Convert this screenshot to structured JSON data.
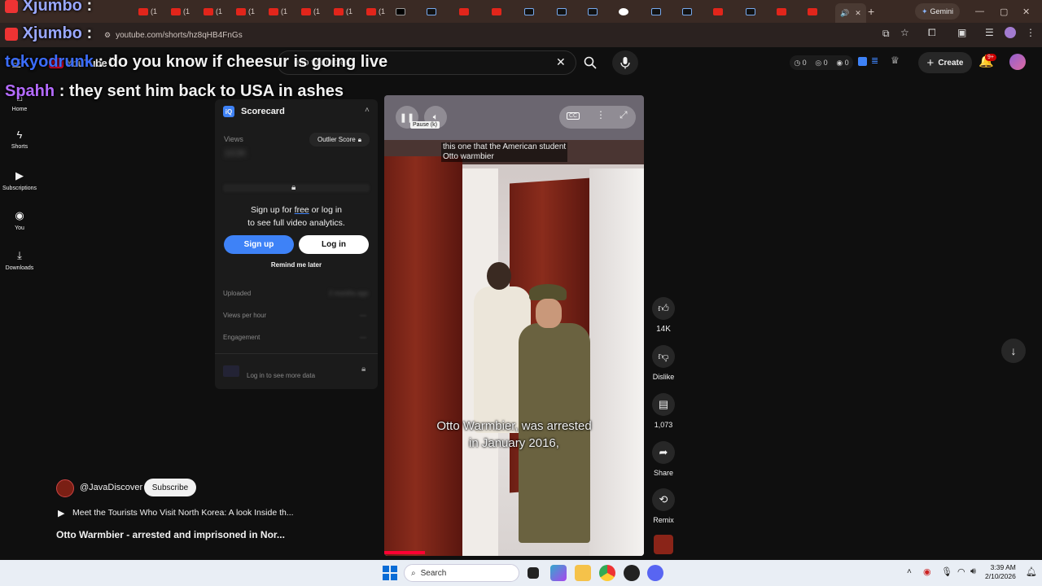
{
  "browser": {
    "tabs_sample_label": "(1",
    "new_tab_label": "+",
    "gemini_label": "Gemini",
    "minimize": "—",
    "maximize": "▢",
    "close": "✕",
    "url": "youtube.com/shorts/hz8qHB4FnGs"
  },
  "overlay_chat": [
    {
      "user": "Xjumbo",
      "sep": ":",
      "msg": "",
      "user_color": "#9aa8ff"
    },
    {
      "user": "Xjumbo",
      "sep": ":",
      "msg": "",
      "user_color": "#9aa8ff"
    },
    {
      "user": "tokyodrunk",
      "sep": ":",
      "msg": "do you know if cheesur is going live",
      "user_color": "#3b6dff"
    },
    {
      "user": "Spahh",
      "sep": ":",
      "msg": "they sent him back to USA in ashes",
      "user_color": "#b46bff"
    }
  ],
  "youtube": {
    "logo_text": "YouTube",
    "region": "MX",
    "search_value": "otto warmbier",
    "counters": [
      "0",
      "0",
      "0"
    ],
    "create_label": "Create",
    "notif_badge": "9+",
    "sidebar": [
      {
        "label": "Home",
        "icon": "home-icon"
      },
      {
        "label": "Shorts",
        "icon": "shorts-icon"
      },
      {
        "label": "Subscriptions",
        "icon": "subscriptions-icon"
      },
      {
        "label": "You",
        "icon": "you-icon"
      },
      {
        "label": "Downloads",
        "icon": "downloads-icon"
      }
    ]
  },
  "scorecard": {
    "title": "Scorecard",
    "views_label": "Views",
    "views_value": "163K",
    "outlier_label": "Outlier Score",
    "signup_line1_a": "Sign up for ",
    "signup_free": "free",
    "signup_line1_b": " or log in",
    "signup_line2": "to see full video analytics.",
    "signup_button": "Sign up",
    "login_button": "Log in",
    "remind_label": "Remind me later",
    "uploaded_label": "Uploaded",
    "uploaded_value": "2 months ago",
    "vph_label": "Views per hour",
    "vph_value": "—",
    "engagement_label": "Engagement",
    "engagement_value": "—",
    "login_more": "Log in to see more data"
  },
  "video": {
    "top_caption_l1": "this one that the American student",
    "top_caption_l2": "Otto warmbier",
    "subtitle_l1": "Otto Warmbier, was arrested",
    "subtitle_l2": "in January 2016,",
    "tooltip": "Pause (k)",
    "cc_label": "CC"
  },
  "actions": {
    "likes": "14K",
    "dislike_label": "Dislike",
    "comments": "1,073",
    "share_label": "Share",
    "remix_label": "Remix"
  },
  "channel": {
    "handle": "@JavaDiscover",
    "subscribe_label": "Subscribe",
    "playlist_title": "Meet the Tourists Who Visit North Korea: A look Inside th...",
    "video_title": "Otto Warmbier - arrested and imprisoned in Nor..."
  },
  "taskbar": {
    "search_placeholder": "Search",
    "time": "3:39 AM",
    "date": "2/10/2026"
  },
  "colors": {
    "accent_blue": "#3e82f7",
    "yt_red": "#ff0033"
  }
}
